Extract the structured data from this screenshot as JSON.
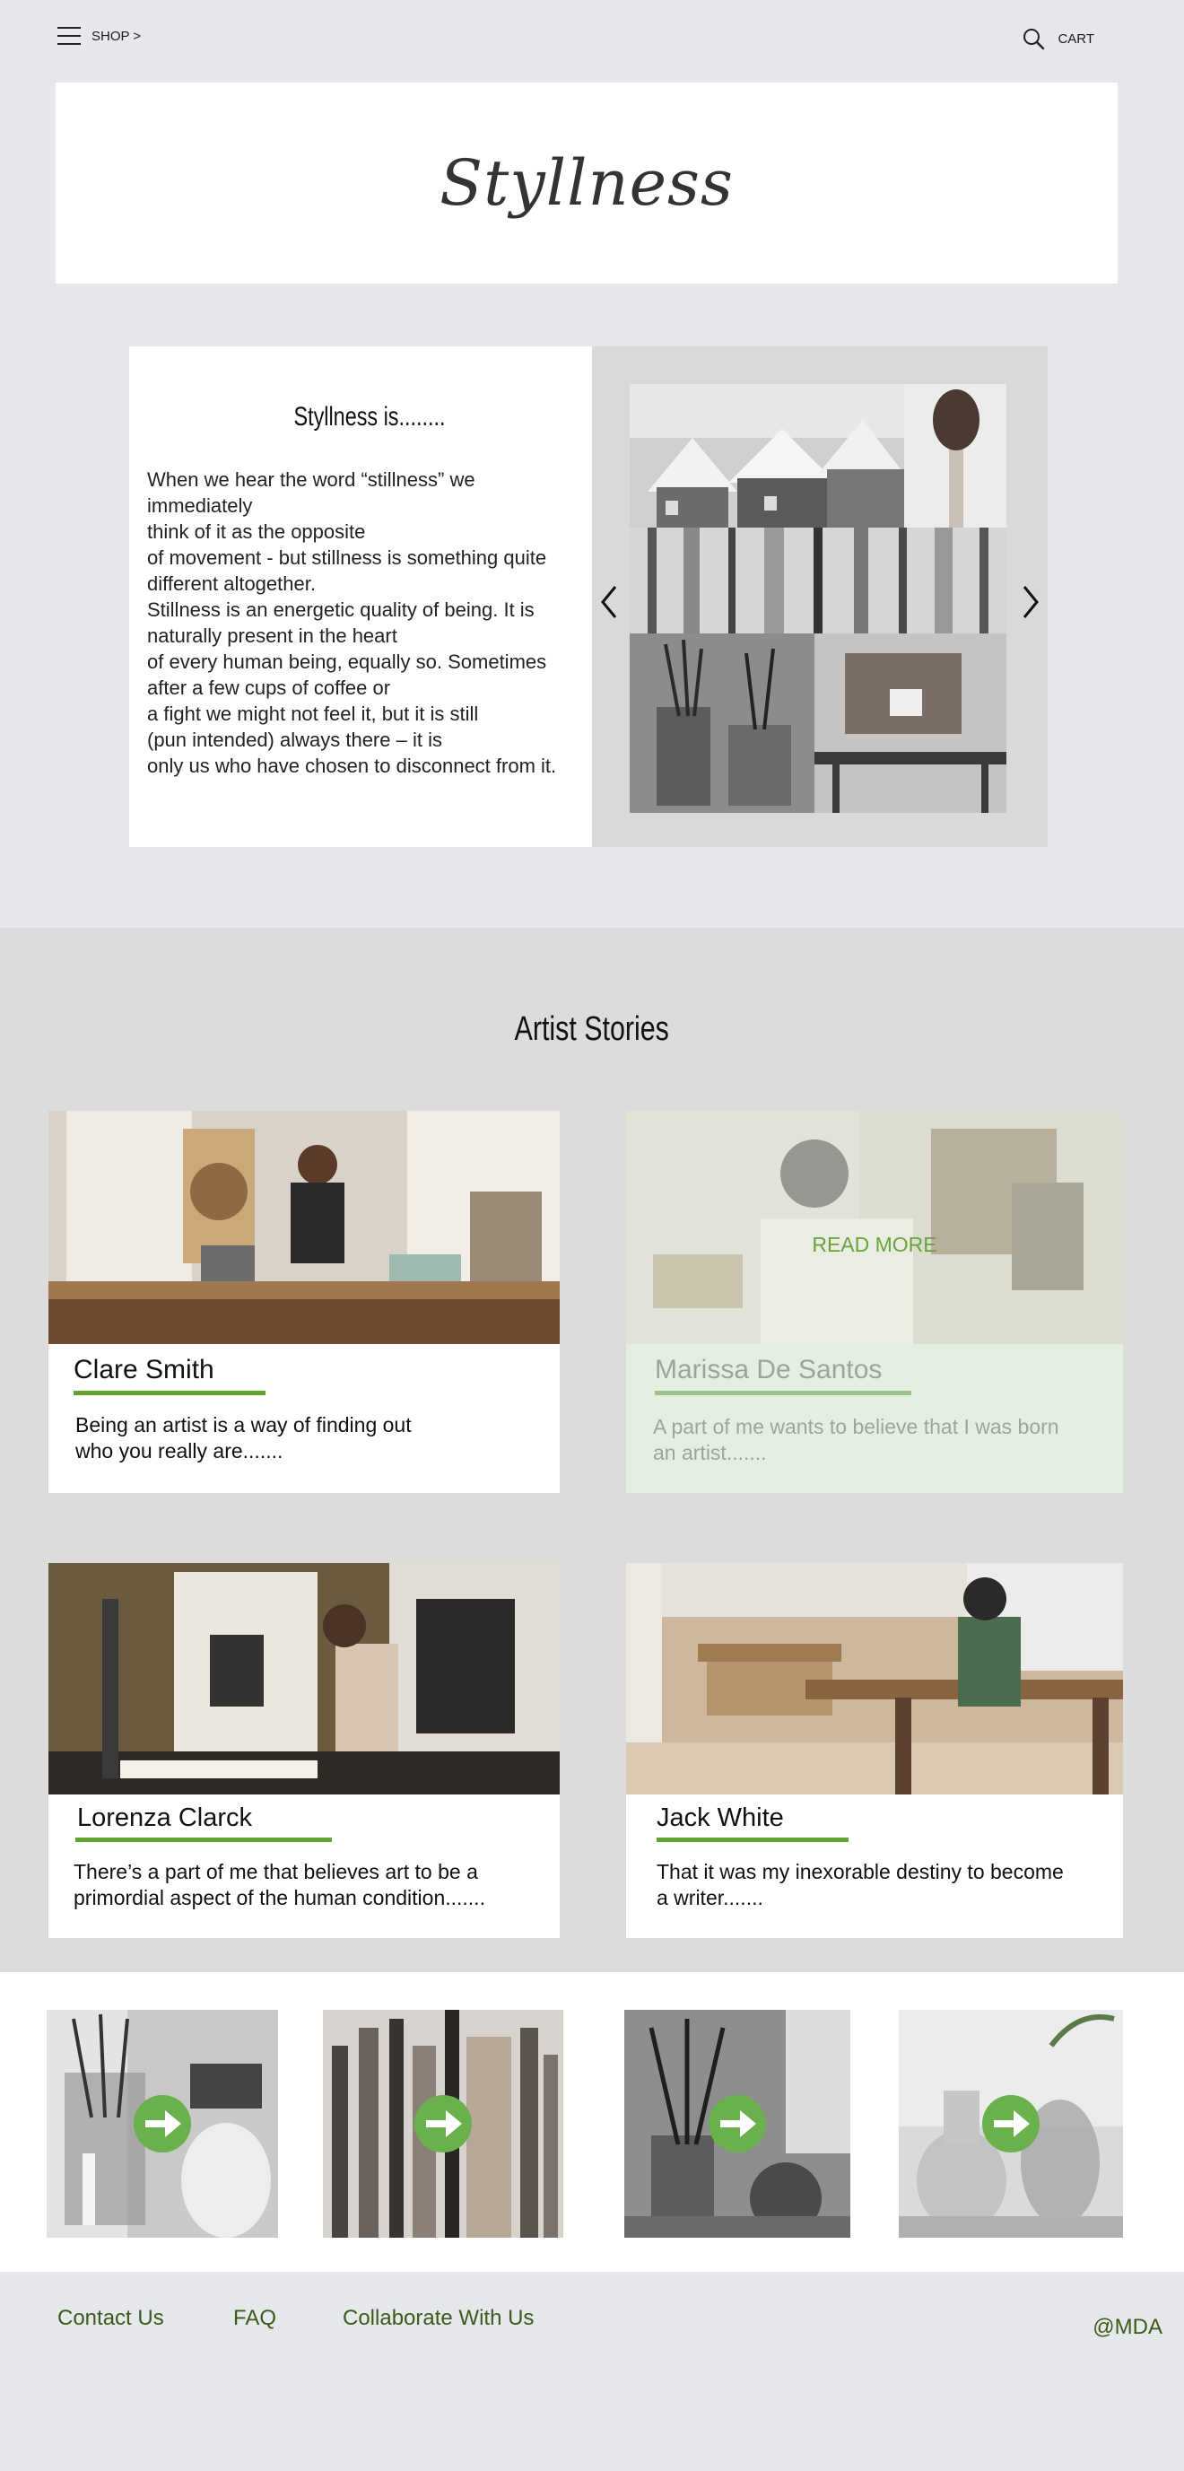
{
  "nav": {
    "shop_label": "SHOP >",
    "cart_label": "CART"
  },
  "brand": {
    "name": "Styllness"
  },
  "intro": {
    "title": "Styllness is........",
    "body": "When we hear the word “stillness” we\nimmediately\nthink of it as the opposite\nof movement - but stillness is something quite\ndifferent altogether.\nStillness is an energetic quality of being. It is\nnaturally present in the heart\nof every human being, equally so. Sometimes\nafter a few cups of coffee or\na fight we might not feel it, but it is still\n(pun intended) always there – it is\nonly us who have chosen to disconnect from it."
  },
  "stories": {
    "title": "Artist Stories",
    "read_more": "READ MORE",
    "cards": [
      {
        "name": "Clare Smith",
        "desc": "Being an artist is a way of finding out\nwho you really are......."
      },
      {
        "name": "Marissa De Santos",
        "desc": "A part of me wants to believe that I was born\nan artist......."
      },
      {
        "name": "Lorenza Clarck",
        "desc": "There’s a part of me that believes art to be a\nprimordial aspect of the human condition......."
      },
      {
        "name": "Jack White",
        "desc": "That it was my inexorable destiny to become\na writer......."
      }
    ]
  },
  "footer": {
    "links": [
      "Contact Us",
      "FAQ",
      "Collaborate With Us"
    ],
    "credit": "@MDA"
  },
  "colors": {
    "accent_green": "#63a52c",
    "footer_link": "#3c5a1a",
    "page_bg": "#e7e8ec"
  }
}
